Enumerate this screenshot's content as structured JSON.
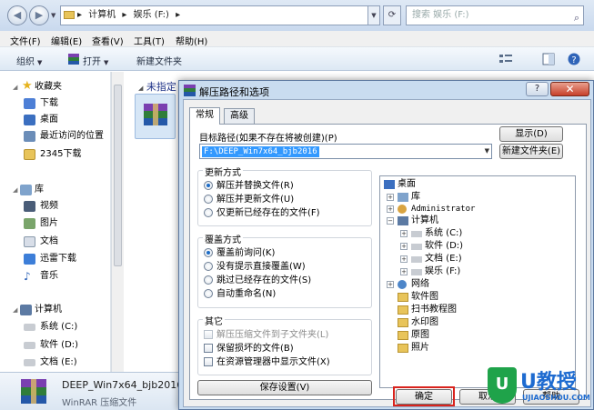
{
  "explorer": {
    "address": {
      "segments": [
        "▸",
        "计算机",
        "▸",
        "娱乐 (F:)",
        "▸"
      ],
      "search_placeholder": "搜索 娱乐 (F:)"
    },
    "menu": [
      "文件(F)",
      "编辑(E)",
      "查看(V)",
      "工具(T)",
      "帮助(H)"
    ],
    "toolbar": {
      "organize": "组织",
      "open": "打开",
      "new_folder": "新建文件夹"
    },
    "navpane": {
      "favorites": "收藏夹",
      "fav_items": [
        "下载",
        "桌面",
        "最近访问的位置",
        "2345下载"
      ],
      "libraries": "库",
      "lib_items": [
        "视频",
        "图片",
        "文档",
        "迅雷下载",
        "音乐"
      ],
      "computer": "计算机",
      "drives": [
        "系统 (C:)",
        "软件 (D:)",
        "文档 (E:)"
      ]
    },
    "content_header": "未指定",
    "details": {
      "file_name": "DEEP_Win7x64_bjb2016....",
      "file_type": "WinRAR 压缩文件"
    }
  },
  "dialog": {
    "title": "解压路径和选项",
    "help_label": "?",
    "close_label": "✕",
    "tabs": [
      "常规",
      "高级"
    ],
    "target_label": "目标路径(如果不存在将被创建)(P)",
    "target_value": "F:\\DEEP_Win7x64_bjb2016",
    "show_button": "显示(D)",
    "new_folder_button": "新建文件夹(E)",
    "update_mode": {
      "title": "更新方式",
      "options": [
        "解压并替换文件(R)",
        "解压并更新文件(U)",
        "仅更新已经存在的文件(F)"
      ],
      "selected": 0
    },
    "overwrite_mode": {
      "title": "覆盖方式",
      "options": [
        "覆盖前询问(K)",
        "没有提示直接覆盖(W)",
        "跳过已经存在的文件(S)",
        "自动重命名(N)"
      ],
      "selected": 0
    },
    "misc": {
      "title": "其它",
      "options": [
        "解压压缩文件到子文件夹(L)",
        "保留损坏的文件(B)",
        "在资源管理器中显示文件(X)"
      ]
    },
    "save_settings_button": "保存设置(V)",
    "tree": {
      "desktop": "桌面",
      "library": "库",
      "user": "Administrator",
      "computer": "计算机",
      "drives": [
        "系统 (C:)",
        "软件 (D:)",
        "文档 (E:)",
        "娱乐 (F:)"
      ],
      "network": "网络",
      "folders": [
        "软件图",
        "扫书教程图",
        "水印图",
        "原图",
        "照片"
      ]
    },
    "ok_button": "确定",
    "cancel_button": "取消",
    "help_button": "帮助"
  },
  "watermark": {
    "logo_text": "U教授",
    "url": "UJIAOSHOU.COM"
  },
  "colors": {
    "selection": "#3399ff",
    "highlight": "#d9231d",
    "dialog_frame": "#c9dcf0"
  }
}
